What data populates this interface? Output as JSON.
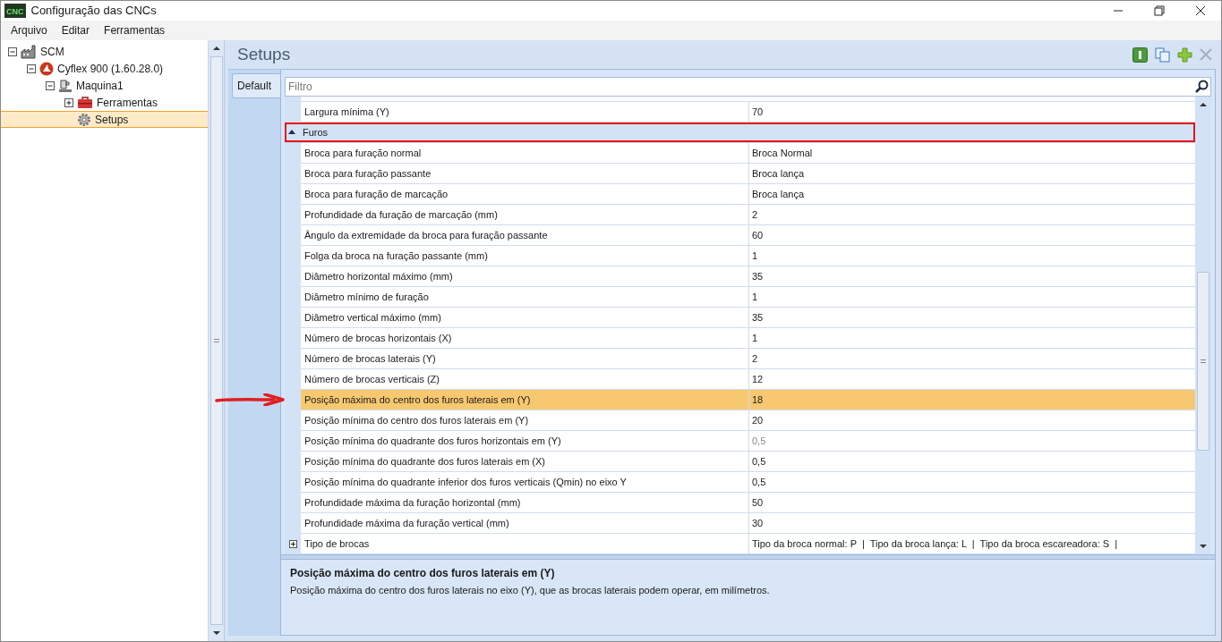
{
  "window": {
    "title": "Configuração das CNCs",
    "app_badge": "CNC"
  },
  "menu": [
    "Arquivo",
    "Editar",
    "Ferramentas"
  ],
  "tree": [
    {
      "label": "SCM",
      "kind": "factory",
      "expanded": true,
      "selected": false,
      "children": [
        {
          "label": "Cyflex 900 (1.60.28.0)",
          "kind": "brand",
          "expanded": true,
          "selected": false,
          "children": [
            {
              "label": "Maquina1",
              "kind": "machine",
              "expanded": true,
              "selected": false,
              "children": [
                {
                  "label": "Ferramentas",
                  "kind": "toolbox",
                  "expanded": false,
                  "selected": false
                },
                {
                  "label": "Setups",
                  "kind": "gear",
                  "selected": true
                }
              ]
            }
          ]
        }
      ]
    }
  ],
  "panel": {
    "title": "Setups",
    "tabs": [
      {
        "label": "Default",
        "selected": true
      }
    ],
    "filter": {
      "placeholder": "Filtro"
    }
  },
  "rows": [
    {
      "kind": "property",
      "name": "Largura mínima (Y)",
      "value": "70",
      "readonly": false,
      "selected": false
    },
    {
      "kind": "group",
      "name": "Furos",
      "expanded": true
    },
    {
      "kind": "property",
      "name": "Broca para furação normal",
      "value": "Broca Normal",
      "readonly": false,
      "selected": false
    },
    {
      "kind": "property",
      "name": "Broca para furação passante",
      "value": "Broca lança",
      "readonly": false,
      "selected": false
    },
    {
      "kind": "property",
      "name": "Broca para furação de marcação",
      "value": "Broca lança",
      "readonly": false,
      "selected": false
    },
    {
      "kind": "property",
      "name": "Profundidade da furação de marcação (mm)",
      "value": "2",
      "readonly": false,
      "selected": false
    },
    {
      "kind": "property",
      "name": "Ângulo da extremidade da broca para furação passante",
      "value": "60",
      "readonly": false,
      "selected": false
    },
    {
      "kind": "property",
      "name": "Folga da broca na furação passante (mm)",
      "value": "1",
      "readonly": false,
      "selected": false
    },
    {
      "kind": "property",
      "name": "Diâmetro horizontal máximo (mm)",
      "value": "35",
      "readonly": false,
      "selected": false
    },
    {
      "kind": "property",
      "name": "Diâmetro mínimo de furação",
      "value": "1",
      "readonly": false,
      "selected": false
    },
    {
      "kind": "property",
      "name": "Diâmetro vertical máximo (mm)",
      "value": "35",
      "readonly": false,
      "selected": false
    },
    {
      "kind": "property",
      "name": "Número de brocas horizontais (X)",
      "value": "1",
      "readonly": false,
      "selected": false
    },
    {
      "kind": "property",
      "name": "Número de brocas laterais (Y)",
      "value": "2",
      "readonly": false,
      "selected": false
    },
    {
      "kind": "property",
      "name": "Número de brocas verticais (Z)",
      "value": "12",
      "readonly": false,
      "selected": false
    },
    {
      "kind": "property",
      "name": "Posição máxima do centro dos furos laterais em (Y)",
      "value": "18",
      "readonly": false,
      "selected": true
    },
    {
      "kind": "property",
      "name": "Posição mínima do centro dos furos laterais em (Y)",
      "value": "20",
      "readonly": false,
      "selected": false
    },
    {
      "kind": "property",
      "name": "Posição mínima do quadrante dos furos horizontais em (Y)",
      "value": "0,5",
      "readonly": true,
      "selected": false
    },
    {
      "kind": "property",
      "name": "Posição mínima do quadrante dos furos laterais em (X)",
      "value": "0,5",
      "readonly": false,
      "selected": false
    },
    {
      "kind": "property",
      "name": "Posição mínima do quadrante inferior dos furos verticais (Qmin) no eixo Y",
      "value": "0,5",
      "readonly": false,
      "selected": false
    },
    {
      "kind": "property",
      "name": "Profundidade máxima da furação horizontal (mm)",
      "value": "50",
      "readonly": false,
      "selected": false
    },
    {
      "kind": "property",
      "name": "Profundidade máxima da furação vertical (mm)",
      "value": "30",
      "readonly": false,
      "selected": false
    },
    {
      "kind": "expandable",
      "name": "Tipo de brocas",
      "value": "Tipo da broca normal: P  |  Tipo da broca lança: L  |  Tipo da broca escareadora: S  |",
      "expanded": false,
      "readonly": false,
      "selected": false
    }
  ],
  "annotations": {
    "group_box": true,
    "selection_arrow": true
  },
  "description": {
    "title": "Posição máxima do centro dos furos laterais em (Y)",
    "text": "Posição máxima do centro dos furos laterais no eixo (Y), que as brocas laterais podem operar, em milímetros."
  }
}
